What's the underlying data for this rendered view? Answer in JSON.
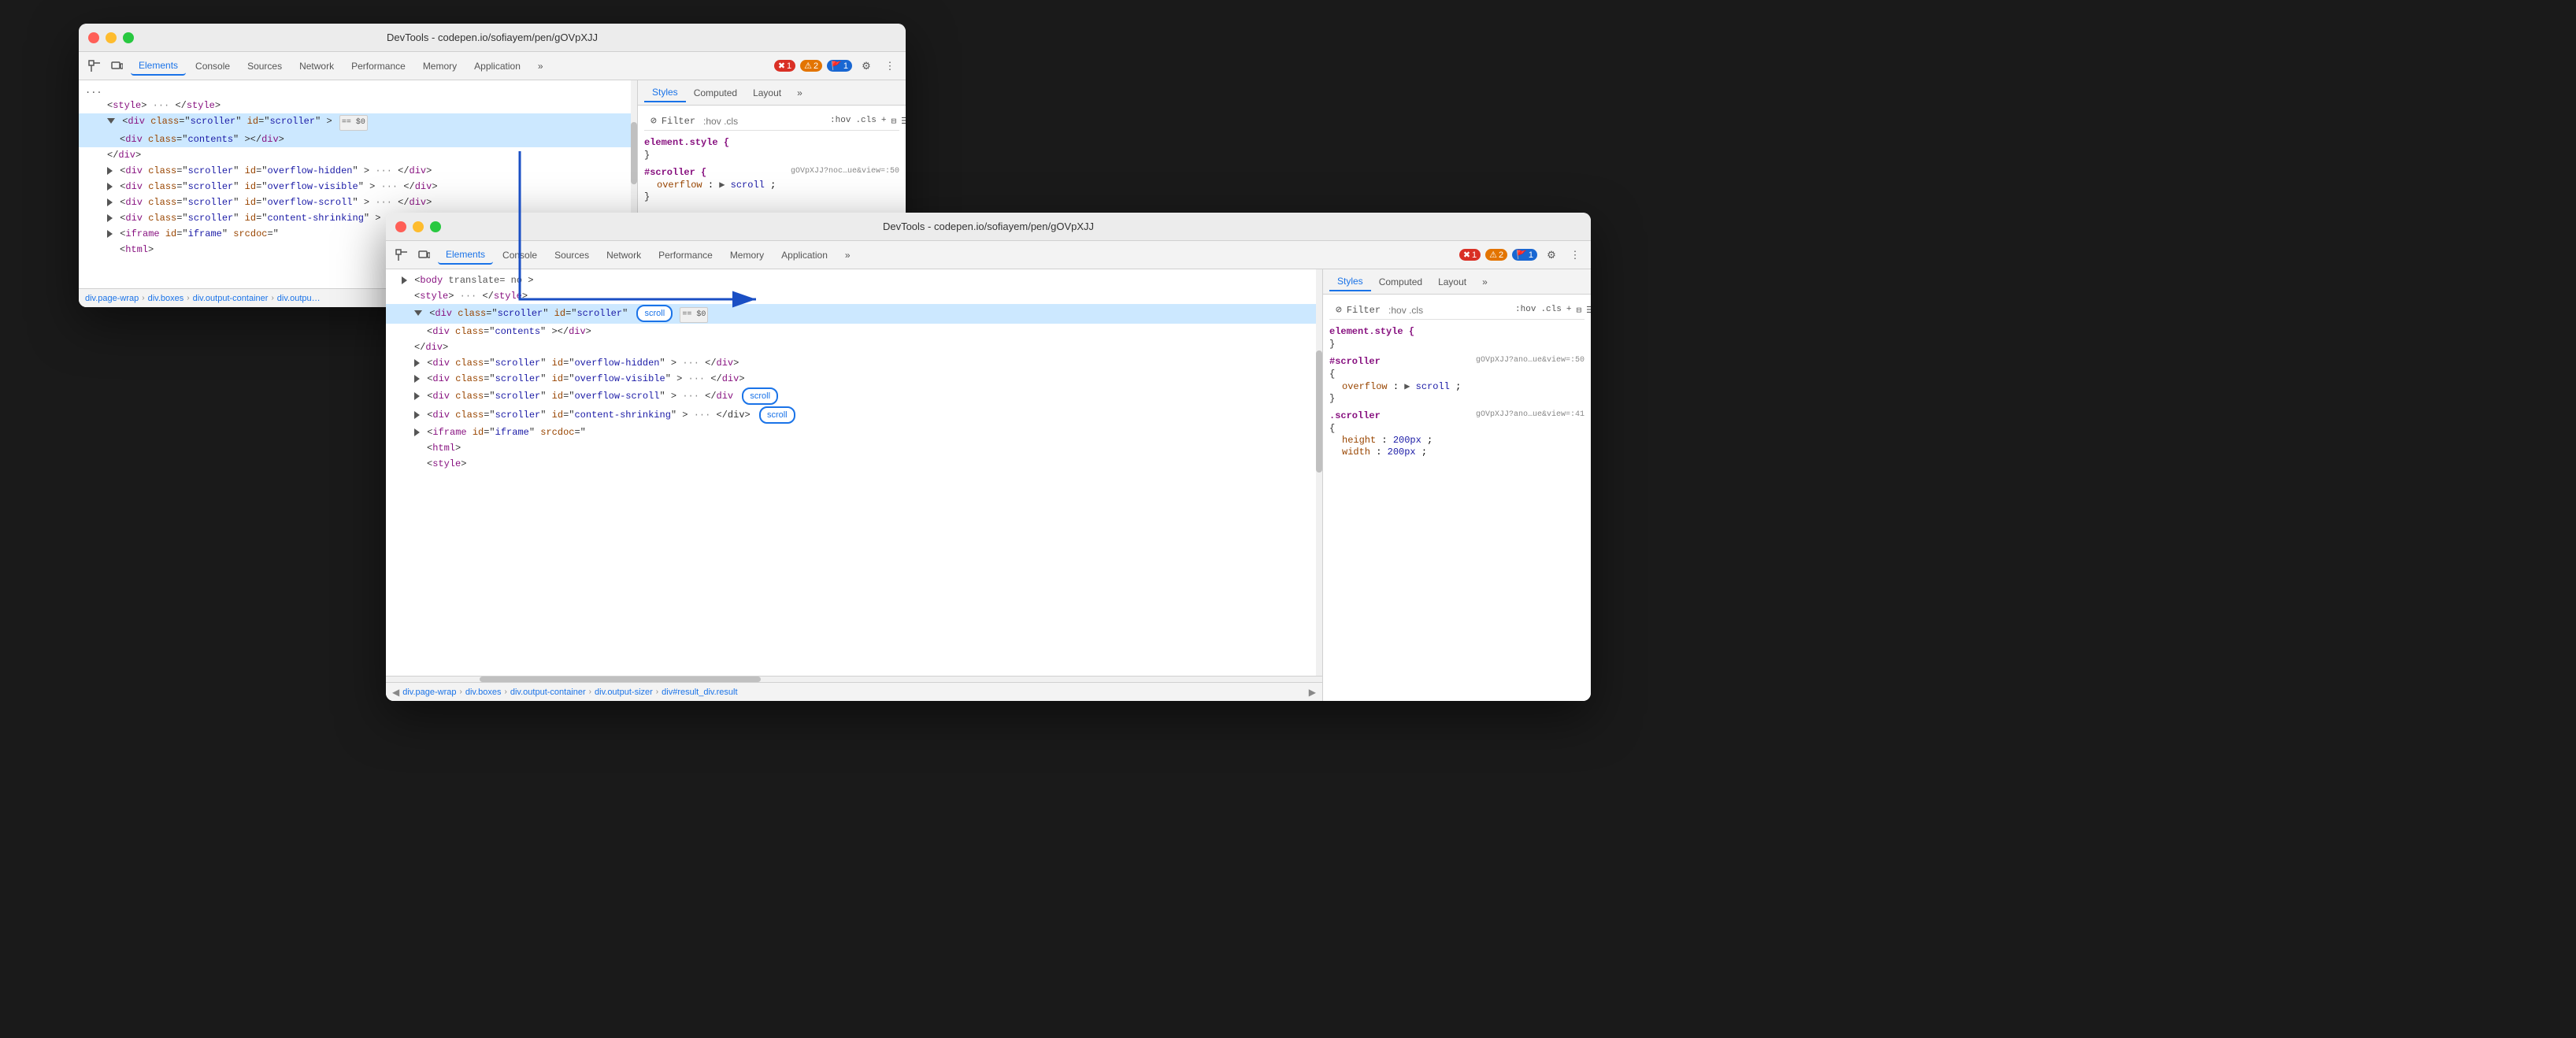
{
  "window1": {
    "title": "DevTools - codepen.io/sofiayem/pen/gOVpXJJ",
    "tabs": [
      "Elements",
      "Console",
      "Sources",
      "Network",
      "Performance",
      "Memory",
      "Application"
    ],
    "active_tab": "Elements",
    "badges": {
      "error": "1",
      "warning": "2",
      "info": "1"
    },
    "styles_tabs": [
      "Styles",
      "Computed",
      "Layout"
    ],
    "styles_active": "Styles",
    "filter_placeholder": ":hov .cls",
    "element_style": "element.style {",
    "element_style_close": "}",
    "scroller_rule": "#scroller {",
    "scroller_origin": "gOVpXJJ?noc…ue&view=:50",
    "overflow_prop": "overflow:",
    "overflow_val": "scroll;",
    "scroller_close": "}",
    "html_lines": [
      {
        "indent": 1,
        "content": "<style> ··· </style>",
        "selected": true
      },
      {
        "indent": 1,
        "content": "▼ <div class=\"scroller\" id=\"scroller\"> == $0",
        "selected": true
      },
      {
        "indent": 2,
        "content": "<div class=\"contents\"></div>"
      },
      {
        "indent": 2,
        "content": "</div>"
      },
      {
        "indent": 1,
        "content": "▶ <div class=\"scroller\" id=\"overflow-hidden\"> ··· </div>"
      },
      {
        "indent": 1,
        "content": "▶ <div class=\"scroller\" id=\"overflow-visible\"> ··· </div>"
      },
      {
        "indent": 1,
        "content": "▶ <div class=\"scroller\" id=\"overflow-scroll\"> ··· </div>"
      },
      {
        "indent": 1,
        "content": "▶ <div class=\"scroller\" id=\"content-shrinking\"> ··· </div>"
      },
      {
        "indent": 1,
        "content": "▶ <iframe id=\"iframe\" srcdoc=\""
      },
      {
        "indent": 2,
        "content": "<html>"
      }
    ],
    "breadcrumb": [
      "div.page-wrap",
      "div.boxes",
      "div.output-container",
      "div.outpu…"
    ]
  },
  "window2": {
    "title": "DevTools - codepen.io/sofiayem/pen/gOVpXJJ",
    "tabs": [
      "Elements",
      "Console",
      "Sources",
      "Network",
      "Performance",
      "Memory",
      "Application"
    ],
    "active_tab": "Elements",
    "badges": {
      "error": "1",
      "warning": "2",
      "info": "1"
    },
    "styles_tabs": [
      "Styles",
      "Computed",
      "Layout"
    ],
    "styles_active": "Styles",
    "filter_placeholder": ":hov .cls",
    "element_style": "element.style {",
    "element_style_close": "}",
    "scroller_rule": "#scroller",
    "scroller_origin": "gOVpXJJ?ano…ue&view=:50",
    "scroller_brace": "{",
    "overflow_prop": "overflow:",
    "overflow_val": "▶ scroll;",
    "scroller_close": "}",
    "scroller2_rule": ".scroller",
    "scroller2_origin": "gOVpXJJ?ano…ue&view=:41",
    "scroller2_brace": "{",
    "height_prop": "height:",
    "height_val": "200px;",
    "width_prop": "width:",
    "width_val": "200px;",
    "html_lines": [
      {
        "indent": 1,
        "content": "▶ <body translate= no >"
      },
      {
        "indent": 2,
        "content": "<style> ··· </style>"
      },
      {
        "indent": 2,
        "content": "▼ <div class=\"scroller\" id=\"scroller\"",
        "scroll_badge": "scroll",
        "selected": true,
        "equals": true
      },
      {
        "indent": 3,
        "content": "<div class=\"contents\"></div>"
      },
      {
        "indent": 3,
        "content": "</div>"
      },
      {
        "indent": 2,
        "content": "▶ <div class=\"scroller\" id=\"overflow-hidden\"> ··· </div>"
      },
      {
        "indent": 2,
        "content": "▶ <div class=\"scroller\" id=\"overflow-visible\"> ··· </div>"
      },
      {
        "indent": 2,
        "content": "▶ <div class=\"scroller\" id=\"overflow-scroll\"> ··· </div>",
        "scroll_badge2": "scroll"
      },
      {
        "indent": 2,
        "content": "▶ <div class=\"scroller\" id=\"content-shrinking\"> ··· </div>",
        "scroll_badge3": "scroll"
      },
      {
        "indent": 2,
        "content": "▶ <iframe id=\"iframe\" srcdoc=\""
      },
      {
        "indent": 3,
        "content": "<html>"
      },
      {
        "indent": 3,
        "content": "<style>"
      }
    ],
    "breadcrumb": [
      "div.page-wrap",
      "div.boxes",
      "div.output-container",
      "div.output-sizer",
      "div#result_div.result"
    ]
  }
}
